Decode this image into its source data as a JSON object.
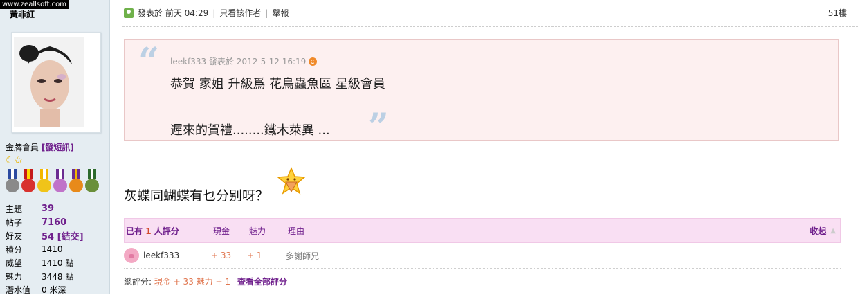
{
  "watermark": "www.zeallsoft.com",
  "author": {
    "name": "黃非紅",
    "group": "金牌會員",
    "pm_label": "[發短訊]",
    "stats": [
      {
        "label": "主題",
        "value": "39"
      },
      {
        "label": "帖子",
        "value": "7160"
      },
      {
        "label": "好友",
        "value": "54",
        "extra": "[結交]"
      },
      {
        "label": "積分",
        "value": "1410"
      },
      {
        "label": "威望",
        "value": "1410 點"
      },
      {
        "label": "魅力",
        "value": "3448 點"
      },
      {
        "label": "潛水值",
        "value": "0 米深"
      }
    ]
  },
  "post": {
    "posted_label": "發表於",
    "posted_time": "前天 04:29",
    "only_author": "只看該作者",
    "report": "舉報",
    "floor": "51樓",
    "quote": {
      "author_line": "leekf333 發表於  2012-5-12 16:19",
      "line1": "恭賀 家姐   升級爲 花鳥蟲魚區 星級會員",
      "line2": "遲來的賀禮........鐵木萊異 ..."
    },
    "body": "灰蝶同蝴蝶有乜分别呀？"
  },
  "rating": {
    "head_prefix": "已有",
    "count": "1",
    "head_suffix": "人評分",
    "col_cash": "現金",
    "col_charm": "魅力",
    "col_reason": "理由",
    "collapse": "收起",
    "rows": [
      {
        "user": "leekf333",
        "cash": "+ 33",
        "charm": "+ 1",
        "reason": "多謝師兄"
      }
    ],
    "total_label": "總評分:",
    "total_value": "現金 + 33  魅力 + 1",
    "view_all": "查看全部評分"
  },
  "colors": {
    "sidebar_bg": "#e5edf2",
    "quote_bg": "#fdf0f0",
    "rate_head_bg": "#f9dff3",
    "accent_purple": "#6f1f8c",
    "accent_orange": "#e0764f"
  }
}
